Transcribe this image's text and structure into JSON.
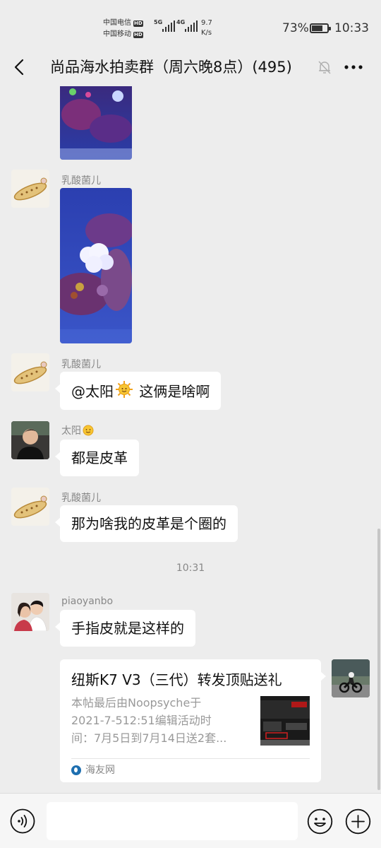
{
  "status_bar": {
    "carrier1": "中国电信",
    "carrier2": "中国移动",
    "hd": "HD",
    "net1": "5G",
    "net2": "4G",
    "speed_value": "9.7",
    "speed_unit": "K/s",
    "battery": "73%",
    "battery_level": 0.73,
    "time": "10:33"
  },
  "header": {
    "title": "尚品海水拍卖群（周六晚8点）(495)",
    "icons": [
      "back-arrow-icon",
      "mute-bell-icon",
      "more-icon"
    ]
  },
  "messages": {
    "m1": {
      "sender": "乳酸菌儿"
    },
    "m2": {
      "sender": "乳酸菌儿",
      "text_before": "@太阳",
      "text_after": " 这俩是啥啊"
    },
    "m3": {
      "sender": "太阳",
      "text": "都是皮革"
    },
    "m4": {
      "sender": "乳酸菌儿",
      "text": "那为啥我的皮革是个圈的"
    },
    "timestamp": "10:31",
    "m5": {
      "sender": "piaoyanbo",
      "text": "手指皮就是这样的"
    },
    "share_card": {
      "title": "纽斯K7 V3（三代）转发顶贴送礼",
      "desc_line1": "本帖最后由Noopsyche于",
      "desc_line2": "2021-7-512:51编辑活动时",
      "desc_line3": "间：7月5日到7月14日送2套...",
      "source": "海友网"
    }
  },
  "input_bar": {
    "icons": [
      "voice-icon",
      "emoji-icon",
      "plus-icon"
    ]
  },
  "colors": {
    "background": "#ededed",
    "bubble": "#ffffff",
    "muted_text": "#888888"
  }
}
